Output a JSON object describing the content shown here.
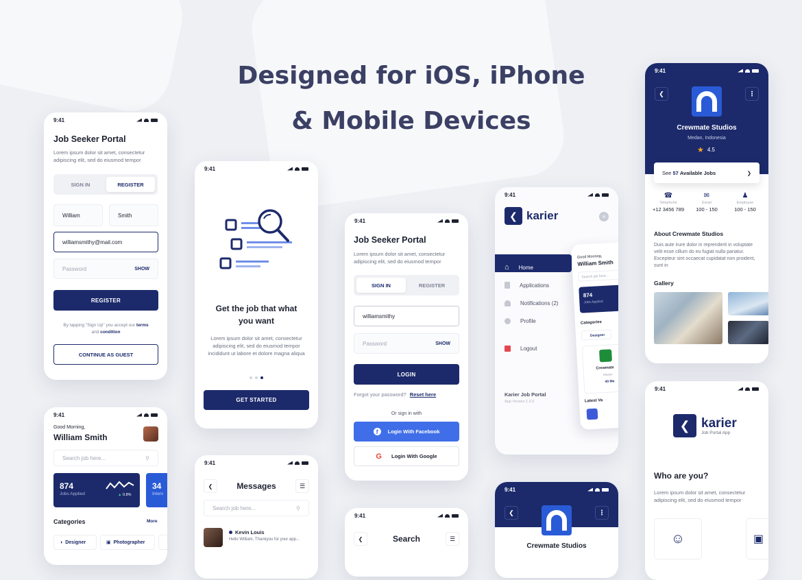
{
  "headline": {
    "line1": "Designed for iOS, iPhone",
    "line2": "& Mobile Devices"
  },
  "time": "9:41",
  "register_screen": {
    "title": "Job Seeker Portal",
    "desc": "Lorem ipsum dolor sit amet, consectetur adipiscing elit, sed do eiusmod tempor",
    "tab_signin": "SIGN IN",
    "tab_register": "REGISTER",
    "first_name": "William",
    "last_name": "Smith",
    "email": "williamsmithy@mail.com",
    "password_placeholder": "Password",
    "show_label": "SHOW",
    "register_button": "REGISTER",
    "terms_prefix": "By tapping \"Sign Up\" you accept our",
    "terms_link": "terms",
    "and": "and",
    "condition_link": "condition",
    "guest_button": "CONTINUE AS GUEST"
  },
  "onboard_screen": {
    "title": "Get the job that what you want",
    "desc": "Lorem ipsum dolor sit amet, consectetur adipiscing elit, sed do eiusmod tempor incididunt ut labore et dolore magna aliqua",
    "button": "GET STARTED"
  },
  "login_screen": {
    "title": "Job Seeker Portal",
    "desc": "Lorem ipsum dolor sit amet, consectetur adipiscing elit, sed do eiusmod tempor",
    "tab_signin": "SIGN IN",
    "tab_register": "REGISTER",
    "username": "williamsmithy",
    "password_placeholder": "Password",
    "show_label": "SHOW",
    "login_button": "LOGIN",
    "forgot": "Forgot your password?",
    "reset": "Reset here",
    "or_sign": "Or sign in with",
    "facebook": "Login With Facebook",
    "google": "Login With Google"
  },
  "menu_screen": {
    "brand": "karier",
    "items": [
      "Home",
      "Applications",
      "Notifications (2)",
      "Profile",
      "Logout"
    ],
    "footer_title": "Karier Job Portal",
    "footer_version": "App Version 1.0.0",
    "peek_greeting": "Good Morning,",
    "peek_name": "William Smith",
    "peek_search": "Search job here...",
    "peek_stat": "874",
    "peek_stat_label": "Jobs Applied",
    "peek_categories": "Categories",
    "peek_chip": "Designer",
    "peek_card_title": "Crewmate",
    "peek_card_sub": "Medan",
    "peek_card_salary": "40 Ma",
    "peek_latest": "Latest Va"
  },
  "company_screen": {
    "name": "Crewmate Studios",
    "location": "Medan, Indonesia",
    "rating": "4.5",
    "jobs_prefix": "See",
    "jobs_count": "57",
    "jobs_suffix": "Available Jobs",
    "stats": [
      {
        "label": "Telephone",
        "value": "+12 3456 789",
        "icon": "phone-icon"
      },
      {
        "label": "Email",
        "value": "100 - 150",
        "icon": "mail-icon"
      },
      {
        "label": "Employee",
        "value": "100 - 150",
        "icon": "person-icon"
      }
    ],
    "about_title": "About Crewmate Studios",
    "about_text": "Duis aute irure dolor in reprenderit in voluptate velit esse cillum do eu fugiat nulla pariatur. Excepteur sint occaecat cupidatat non proident, sunt in",
    "gallery": "Gallery"
  },
  "home_screen": {
    "greeting": "Good Morning,",
    "name": "William Smith",
    "search_placeholder": "Search job here...",
    "stat_value": "874",
    "stat_label": "Jobs Applied",
    "stat_change": "0.8%",
    "stat2_value": "34",
    "stat2_label": "Interv",
    "categories": "Categories",
    "more": "More",
    "chips": [
      "Designer",
      "Photographer"
    ]
  },
  "messages_screen": {
    "title": "Messages",
    "search_placeholder": "Search job here...",
    "contact_name": "Kevin Louis",
    "contact_msg": "Hello William, Thankyou for your app..."
  },
  "search_screen": {
    "title": "Search"
  },
  "company2_screen": {
    "name": "Crewmate Studios"
  },
  "splash_screen": {
    "brand": "karier",
    "sub": "Job Portal App",
    "question": "Who are you?",
    "desc": "Lorem ipsum dolor sit amet, consectetur adipiscing elit, sed do eiusmod tempor"
  },
  "colors": {
    "navy": "#1c2a6b",
    "facebook": "#3f6ee8",
    "background": "#eef0f4"
  }
}
